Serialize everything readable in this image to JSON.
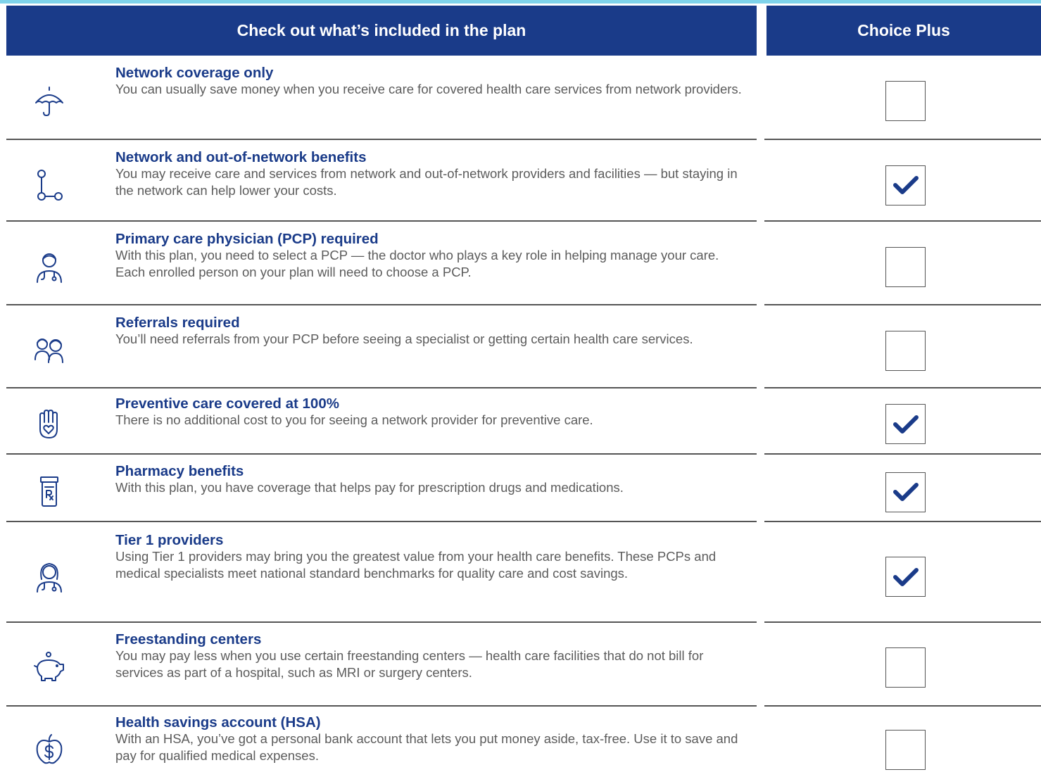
{
  "header": {
    "left_title": "Check out what’s included in the plan",
    "right_title": "Choice Plus"
  },
  "colors": {
    "brand_blue": "#1a3b89",
    "accent_cyan": "#7fd3ea",
    "body_text": "#5c5c5c"
  },
  "rows": [
    {
      "icon": "umbrella-icon",
      "title": "Network coverage only",
      "description": "You can usually save money when you receive care for covered health care services from network providers.",
      "included": false
    },
    {
      "icon": "route-icon",
      "title": "Network and out-of-network benefits",
      "description": "You may receive care and services from network and out-of-network providers and facilities — but staying in the network can help lower your costs.",
      "included": true
    },
    {
      "icon": "doctor-icon",
      "title": "Primary care physician (PCP) required",
      "description": "With this plan, you need to select a PCP — the doctor who plays a key role in helping manage your care. Each enrolled person on your plan will need to choose a PCP.",
      "included": false
    },
    {
      "icon": "referral-people-icon",
      "title": "Referrals required",
      "description": "You’ll need referrals from your PCP before seeing a specialist or getting certain health care services.",
      "included": false
    },
    {
      "icon": "hand-heart-icon",
      "title": "Preventive care covered at 100%",
      "description": "There is no additional cost to you for seeing a network provider for preventive care.",
      "included": true
    },
    {
      "icon": "prescription-bottle-icon",
      "title": "Pharmacy benefits",
      "description": "With this plan, you have coverage that helps pay for prescription drugs and medications.",
      "included": true
    },
    {
      "icon": "female-doctor-icon",
      "title": "Tier 1 providers",
      "description": "Using Tier 1 providers may bring you the greatest value from your health care benefits. These PCPs and medical specialists meet national standard benchmarks for quality care and cost savings.",
      "included": true
    },
    {
      "icon": "piggy-bank-icon",
      "title": "Freestanding centers",
      "description": "You may pay less when you use certain freestanding centers — health care facilities that do not bill for services as part of a hospital, such as MRI or surgery centers.",
      "included": false
    },
    {
      "icon": "apple-dollar-icon",
      "title": "Health savings account (HSA)",
      "description": "With an HSA, you’ve got a personal bank account that lets you put money aside, tax-free. Use it to save and pay for qualified medical expenses.",
      "included": false
    }
  ]
}
